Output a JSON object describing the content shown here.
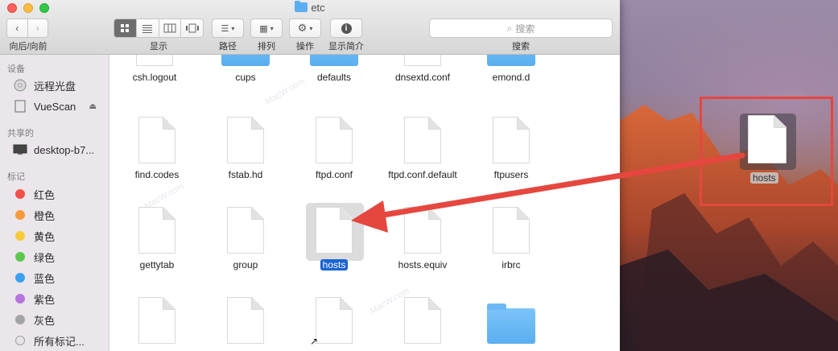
{
  "window": {
    "title": "etc"
  },
  "toolbar": {
    "nav_label": "向后/向前",
    "view_label": "显示",
    "path_label": "路径",
    "arrange_label": "排列",
    "action_label": "操作",
    "info_label": "显示简介",
    "search_placeholder": "搜索",
    "search_label": "搜索"
  },
  "sidebar": {
    "devices_header": "设备",
    "shared_header": "共享的",
    "tags_header": "标记",
    "devices": [
      {
        "label": "远程光盘",
        "icon": "disc-icon"
      },
      {
        "label": "VueScan",
        "icon": "drive-icon"
      }
    ],
    "shared": [
      {
        "label": "desktop-b7...",
        "icon": "monitor-icon"
      }
    ],
    "tags": [
      {
        "label": "红色",
        "color": "#f0504a"
      },
      {
        "label": "橙色",
        "color": "#f59a3b"
      },
      {
        "label": "黄色",
        "color": "#f7ca3c"
      },
      {
        "label": "绿色",
        "color": "#5cc651"
      },
      {
        "label": "蓝色",
        "color": "#3d9ef2"
      },
      {
        "label": "紫色",
        "color": "#b675dc"
      },
      {
        "label": "灰色",
        "color": "#a4a4a8"
      },
      {
        "label": "所有标记..."
      }
    ]
  },
  "files": {
    "row1": [
      "csh.logout",
      "cups",
      "defaults",
      "dnsextd.conf",
      "emond.d"
    ],
    "row2": [
      "find.codes",
      "fstab.hd",
      "ftpd.conf",
      "ftpd.conf.default",
      "ftpusers"
    ],
    "row3": [
      "gettytab",
      "group",
      "hosts",
      "hosts.equiv",
      "irbrc"
    ]
  },
  "drag": {
    "label": "hosts"
  },
  "colors": {
    "selection": "#1a63d6",
    "annotation_red": "#e5473f",
    "folder_blue": "#5aaef0"
  }
}
